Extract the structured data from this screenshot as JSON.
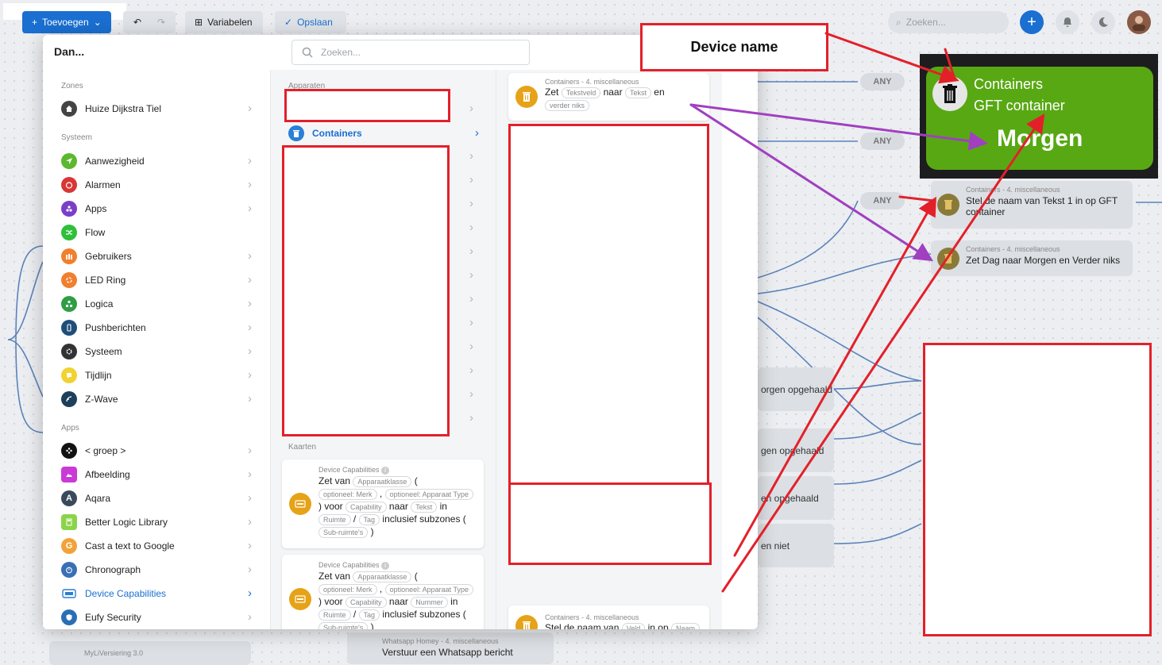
{
  "toolbar": {
    "add_label": "Toevoegen",
    "variables_label": "Variabelen",
    "save_label": "Opslaan",
    "search_placeholder": "Zoeken..."
  },
  "modal": {
    "title": "Dan...",
    "search_placeholder": "Zoeken...",
    "zones_header": "Zones",
    "zone_item": "Huize Dijkstra Tiel",
    "system_header": "Systeem",
    "system_items": [
      "Aanwezigheid",
      "Alarmen",
      "Apps",
      "Flow",
      "Gebruikers",
      "LED Ring",
      "Logica",
      "Pushberichten",
      "Systeem",
      "Tijdlijn",
      "Z-Wave"
    ],
    "apps_header": "Apps",
    "app_items": [
      "< groep >",
      "Afbeelding",
      "Aqara",
      "Better Logic Library",
      "Cast a text to Google",
      "Chronograph",
      "Device Capabilities",
      "Eufy Security"
    ],
    "devices_header": "Apparaten",
    "device_selected": "Containers",
    "cards_header": "Kaarten",
    "cap_card": {
      "sub": "Device Capabilities",
      "w1": "Zet van",
      "t1": "Apparaatklasse",
      "w2": "(",
      "t2": "optioneel: Merk",
      "w3": ",",
      "t3": "optioneel: Apparaat Type",
      "w4": ") voor",
      "t4": "Capability",
      "w5": "naar",
      "t5": "Tekst",
      "w6": "in",
      "t6": "Ruimte",
      "w7": "/",
      "t7": "Tag",
      "w8": "inclusief subzones (",
      "t8": "Sub-ruimte's",
      "w9": ")"
    },
    "cap_card2": {
      "sub": "Device Capabilities",
      "w1": "Zet van",
      "t1": "Apparaatklasse",
      "w2": "(",
      "t2": "optioneel: Merk",
      "w3": ",",
      "t3": "optioneel: Apparaat Type",
      "w4": ") voor",
      "t4": "Capability",
      "w5": "naar",
      "t5": "Nummer",
      "w6": "in",
      "t6": "Ruimte",
      "w7": "/",
      "t7": "Tag",
      "w8": "inclusief subzones (",
      "t8": "Sub-ruimte's",
      "w9": ")"
    },
    "container_card_top": {
      "sub": "Containers - 4. miscellaneous",
      "w1": "Zet",
      "t1": "Tekstveld",
      "w2": "naar",
      "t2": "Tekst",
      "w3": "en",
      "t3": "verder niks"
    },
    "container_card_bottom": {
      "sub": "Containers - 4. miscellaneous",
      "w1": "Stel de naam van",
      "t1": "Veld",
      "w2": "in op",
      "t2": "Naam"
    }
  },
  "background": {
    "any_label": "ANY",
    "card1_sub": "Containers - 4. miscellaneous",
    "card1_text": "Stel de naam van Tekst 1 in op GFT container",
    "card2_sub": "Containers - 4. miscellaneous",
    "card2_text": "Zet Dag naar Morgen en Verder niks",
    "row1": "orgen opgehaald",
    "row2": "gen opgehaald",
    "row3": "en opgehaald",
    "row4": "en niet",
    "bottom_card_sub": "Whatsapp Homey - 4. miscellaneous",
    "bottom_card_text": "Verstuur een Whatsapp bericht",
    "bottom_left_card": "MyLiVersiering 3.0"
  },
  "annotation": {
    "device_name_label": "Device name",
    "device_line1": "Containers",
    "device_line2": "GFT container",
    "device_big": "Morgen"
  },
  "colors": {
    "accent": "#1a6fd1",
    "annotation_red": "#e3202a",
    "annotation_purple": "#a040c0",
    "device_green": "#58a813",
    "container_icon": "#e6a317"
  }
}
